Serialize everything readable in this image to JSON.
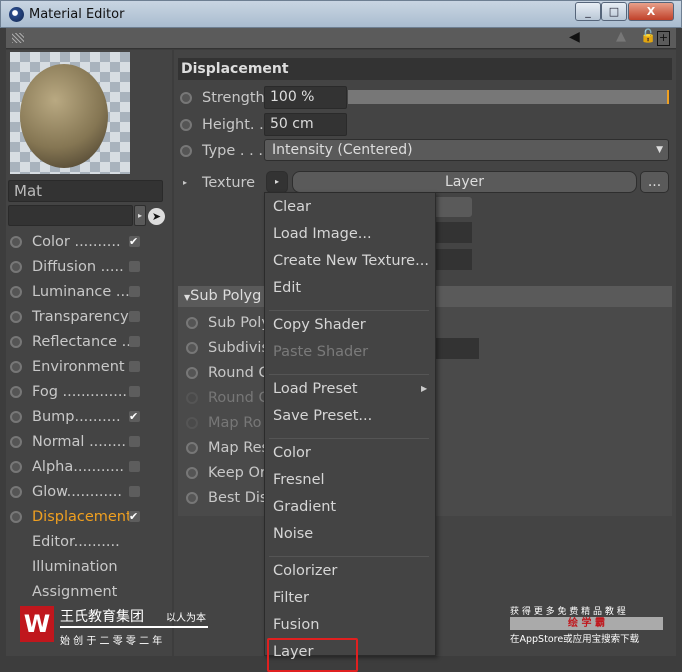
{
  "window": {
    "title": "Material Editor",
    "min": "_",
    "max": "□",
    "close": "X"
  },
  "material": {
    "name": "Mat",
    "link_value": ""
  },
  "channels": [
    {
      "label": "Color ..........",
      "checked": true
    },
    {
      "label": "Diffusion .....",
      "checked": false
    },
    {
      "label": "Luminance ...",
      "checked": false
    },
    {
      "label": "Transparency",
      "checked": false
    },
    {
      "label": "Reflectance ..",
      "checked": false
    },
    {
      "label": "Environment",
      "checked": false
    },
    {
      "label": "Fog ..............",
      "checked": false
    },
    {
      "label": "Bump..........",
      "checked": true
    },
    {
      "label": "Normal ........",
      "checked": false
    },
    {
      "label": "Alpha...........",
      "checked": false
    },
    {
      "label": "Glow............",
      "checked": false
    },
    {
      "label": "Displacement",
      "checked": true,
      "active": true
    }
  ],
  "extra_items": [
    "Editor..........",
    "Illumination",
    "Assignment"
  ],
  "check_mark": "✔",
  "panel": {
    "section_title": "Displacement",
    "strength": {
      "label": "Strength",
      "value": "100 %",
      "fraction": 1.0
    },
    "height": {
      "label": "Height. .",
      "value": "50 cm"
    },
    "type": {
      "label": "Type . . . .",
      "value": "Intensity (Centered)"
    },
    "texture": {
      "label": "Texture",
      "shader": "Layer",
      "more": "..."
    },
    "sub_section_title": "Sub Polyg",
    "sub_rows": [
      {
        "label": "Sub Poly",
        "enabled": true
      },
      {
        "label": "Subdivis",
        "enabled": true
      },
      {
        "label": "Round C",
        "enabled": true
      },
      {
        "label": "Round C",
        "enabled": false
      },
      {
        "label": "Map Ro",
        "enabled": false
      },
      {
        "label": "Map Res",
        "enabled": true
      },
      {
        "label": "Keep Or",
        "enabled": true
      },
      {
        "label": "Best Dis",
        "enabled": true
      }
    ]
  },
  "menu": {
    "groups": [
      [
        {
          "label": "Clear"
        },
        {
          "label": "Load Image..."
        },
        {
          "label": "Create New Texture..."
        },
        {
          "label": "Edit"
        }
      ],
      [
        {
          "label": "Copy Shader"
        },
        {
          "label": "Paste Shader",
          "disabled": true
        }
      ],
      [
        {
          "label": "Load Preset",
          "submenu": true
        },
        {
          "label": "Save Preset..."
        }
      ],
      [
        {
          "label": "Color"
        },
        {
          "label": "Fresnel"
        },
        {
          "label": "Gradient"
        },
        {
          "label": "Noise"
        }
      ],
      [
        {
          "label": "Colorizer"
        },
        {
          "label": "Filter"
        },
        {
          "label": "Fusion"
        },
        {
          "label": "Layer",
          "highlighted": true
        }
      ]
    ]
  },
  "watermark_left": {
    "name": "王氏教育集团",
    "motto": "以人为本",
    "founded": "始 创 于 二 零 零 二 年"
  },
  "watermark_right": {
    "line1": "获 得 更 多 免 费 精 品 教 程",
    "brand": "绘 学 霸",
    "line3": "在AppStore或应用宝搜索下载"
  },
  "colors": {
    "accent": "#f0a020",
    "highlight_box": "#e02020"
  }
}
